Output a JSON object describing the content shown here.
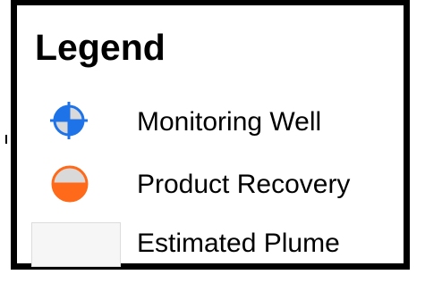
{
  "legend": {
    "title": "Legend",
    "items": [
      {
        "label": "Monitoring Well",
        "icon": "monitoring-well-icon",
        "color_fill": "#1e73e8",
        "color_light": "#d9d9d9"
      },
      {
        "label": "Product Recovery",
        "icon": "product-recovery-icon",
        "color_top": "#d9d9d9",
        "color_bottom": "#ff6a1a"
      },
      {
        "label": "Estimated Plume",
        "icon": "plume-swatch",
        "color_fill": "#f6f6f6"
      }
    ]
  }
}
